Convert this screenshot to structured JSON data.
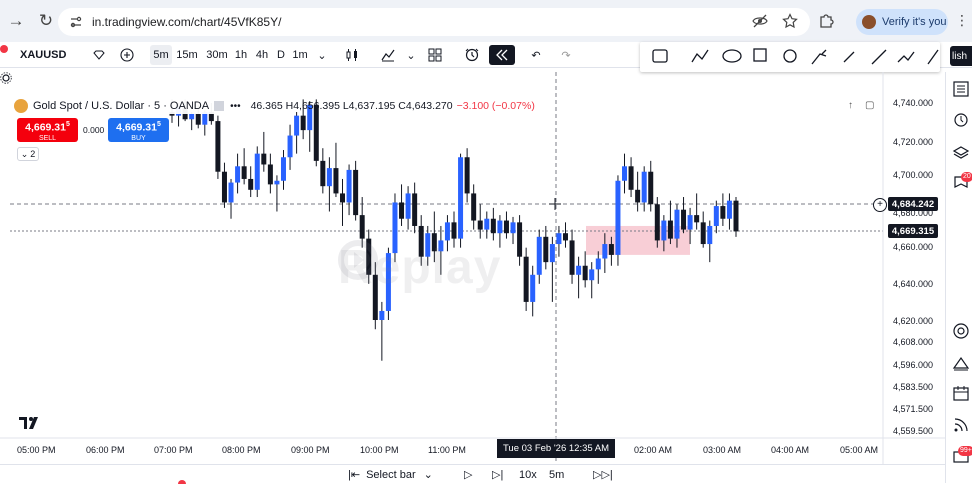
{
  "browser": {
    "url": "in.tradingview.com/chart/45VfK85Y/",
    "verify_label": "Verify it's you"
  },
  "toolbar": {
    "symbol": "XAUUSD",
    "timeframes": [
      "5m",
      "15m",
      "30m",
      "1h",
      "4h",
      "D",
      "1m"
    ],
    "active_timeframe": "5m",
    "publish_label": "lish"
  },
  "legend": {
    "title": "Gold Spot / U.S. Dollar · 5 · OANDA",
    "ohlc": "46.365 H4,656.395 L4,637.195 C4,643.270",
    "change": "−3.100 (−0.07%)",
    "sell_price": "4,669.31",
    "sell_sup": "5",
    "sell_label": "SELL",
    "buy_price": "4,669.31",
    "buy_sup": "5",
    "buy_label": "BUY",
    "spread": "0.000",
    "collapse_count": "2"
  },
  "price_axis": {
    "labels": [
      "4,740.000",
      "4,720.000",
      "4,700.000",
      "4,680.000",
      "4,660.000",
      "4,640.000",
      "4,620.000",
      "4,608.000",
      "4,596.000",
      "4,583.500",
      "4,571.500",
      "4,559.500"
    ],
    "crosshair_price": "4,684.242",
    "current_price": "4,669.315"
  },
  "time_axis": {
    "labels": [
      "05:00 PM",
      "06:00 PM",
      "07:00 PM",
      "08:00 PM",
      "09:00 PM",
      "10:00 PM",
      "11:00 PM",
      "02:00 AM",
      "03:00 AM",
      "04:00 AM",
      "05:00 AM"
    ],
    "hover_time": "Tue 03 Feb '26   12:35 AM"
  },
  "watermark": "Replay",
  "replay_bar": {
    "select_bar": "Select bar",
    "speed": "10x",
    "interval": "5m"
  },
  "sidebar_badges": [
    "20",
    "99+"
  ],
  "colors": {
    "bull": "#2962ff",
    "bear": "#131722",
    "zone": "#f7c6cf",
    "sell": "#f4000d",
    "buy": "#1e6ff0"
  },
  "chart_data": {
    "type": "candlestick",
    "symbol": "Gold Spot / U.S. Dollar",
    "interval": "5",
    "ylim": [
      4559.5,
      4745
    ],
    "zone": {
      "from_price": 4672,
      "to_price": 4656
    },
    "candles": [
      [
        4735,
        4742,
        4729,
        4733
      ],
      [
        4733,
        4740,
        4727,
        4738
      ],
      [
        4738,
        4742,
        4730,
        4731
      ],
      [
        4731,
        4735,
        4725,
        4734
      ],
      [
        4734,
        4739,
        4726,
        4728
      ],
      [
        4728,
        4736,
        4722,
        4735
      ],
      [
        4735,
        4740,
        4728,
        4730
      ],
      [
        4730,
        4733,
        4698,
        4702
      ],
      [
        4702,
        4707,
        4682,
        4685
      ],
      [
        4685,
        4698,
        4676,
        4696
      ],
      [
        4696,
        4712,
        4690,
        4705
      ],
      [
        4705,
        4715,
        4695,
        4698
      ],
      [
        4698,
        4705,
        4688,
        4692
      ],
      [
        4692,
        4716,
        4688,
        4712
      ],
      [
        4712,
        4724,
        4702,
        4706
      ],
      [
        4706,
        4712,
        4690,
        4695
      ],
      [
        4695,
        4700,
        4680,
        4697
      ],
      [
        4697,
        4714,
        4692,
        4710
      ],
      [
        4710,
        4728,
        4703,
        4722
      ],
      [
        4722,
        4735,
        4712,
        4733
      ],
      [
        4733,
        4742,
        4720,
        4725
      ],
      [
        4725,
        4741,
        4713,
        4739
      ],
      [
        4739,
        4742,
        4705,
        4708
      ],
      [
        4708,
        4715,
        4690,
        4694
      ],
      [
        4694,
        4710,
        4680,
        4704
      ],
      [
        4704,
        4718,
        4688,
        4690
      ],
      [
        4690,
        4698,
        4672,
        4685
      ],
      [
        4685,
        4706,
        4678,
        4703
      ],
      [
        4703,
        4708,
        4675,
        4678
      ],
      [
        4678,
        4688,
        4660,
        4665
      ],
      [
        4665,
        4670,
        4640,
        4645
      ],
      [
        4645,
        4652,
        4615,
        4620
      ],
      [
        4620,
        4630,
        4598,
        4625
      ],
      [
        4625,
        4660,
        4620,
        4657
      ],
      [
        4657,
        4690,
        4652,
        4685
      ],
      [
        4685,
        4695,
        4672,
        4676
      ],
      [
        4676,
        4694,
        4670,
        4690
      ],
      [
        4690,
        4696,
        4668,
        4672
      ],
      [
        4672,
        4678,
        4650,
        4655
      ],
      [
        4655,
        4672,
        4650,
        4668
      ],
      [
        4668,
        4680,
        4652,
        4658
      ],
      [
        4658,
        4672,
        4645,
        4664
      ],
      [
        4664,
        4678,
        4658,
        4674
      ],
      [
        4674,
        4680,
        4660,
        4665
      ],
      [
        4665,
        4712,
        4660,
        4710
      ],
      [
        4710,
        4715,
        4685,
        4690
      ],
      [
        4690,
        4695,
        4670,
        4675
      ],
      [
        4675,
        4684,
        4665,
        4670
      ],
      [
        4670,
        4680,
        4665,
        4676
      ],
      [
        4676,
        4682,
        4664,
        4668
      ],
      [
        4668,
        4678,
        4660,
        4675
      ],
      [
        4675,
        4680,
        4665,
        4668
      ],
      [
        4668,
        4677,
        4662,
        4674
      ],
      [
        4674,
        4678,
        4650,
        4655
      ],
      [
        4655,
        4660,
        4625,
        4630
      ],
      [
        4630,
        4650,
        4622,
        4645
      ],
      [
        4645,
        4670,
        4640,
        4666
      ],
      [
        4666,
        4672,
        4648,
        4652
      ],
      [
        4652,
        4666,
        4630,
        4662
      ],
      [
        4662,
        4672,
        4655,
        4668
      ],
      [
        4668,
        4674,
        4660,
        4664
      ],
      [
        4664,
        4670,
        4640,
        4645
      ],
      [
        4645,
        4655,
        4632,
        4650
      ],
      [
        4650,
        4658,
        4638,
        4642
      ],
      [
        4642,
        4652,
        4632,
        4648
      ],
      [
        4648,
        4658,
        4640,
        4654
      ],
      [
        4654,
        4668,
        4646,
        4662
      ],
      [
        4662,
        4666,
        4650,
        4656
      ],
      [
        4656,
        4700,
        4650,
        4697
      ],
      [
        4697,
        4712,
        4690,
        4705
      ],
      [
        4705,
        4710,
        4688,
        4692
      ],
      [
        4692,
        4702,
        4680,
        4685
      ],
      [
        4685,
        4705,
        4680,
        4702
      ],
      [
        4702,
        4708,
        4680,
        4684
      ],
      [
        4684,
        4688,
        4660,
        4664
      ],
      [
        4664,
        4678,
        4658,
        4675
      ],
      [
        4675,
        4686,
        4662,
        4665
      ],
      [
        4665,
        4684,
        4660,
        4681
      ],
      [
        4681,
        4688,
        4668,
        4670
      ],
      [
        4670,
        4682,
        4662,
        4678
      ],
      [
        4678,
        4690,
        4670,
        4674
      ],
      [
        4674,
        4680,
        4660,
        4662
      ],
      [
        4662,
        4675,
        4652,
        4672
      ],
      [
        4672,
        4686,
        4668,
        4683
      ],
      [
        4683,
        4690,
        4672,
        4676
      ],
      [
        4676,
        4690,
        4670,
        4686
      ],
      [
        4686,
        4688,
        4666,
        4669
      ]
    ]
  }
}
